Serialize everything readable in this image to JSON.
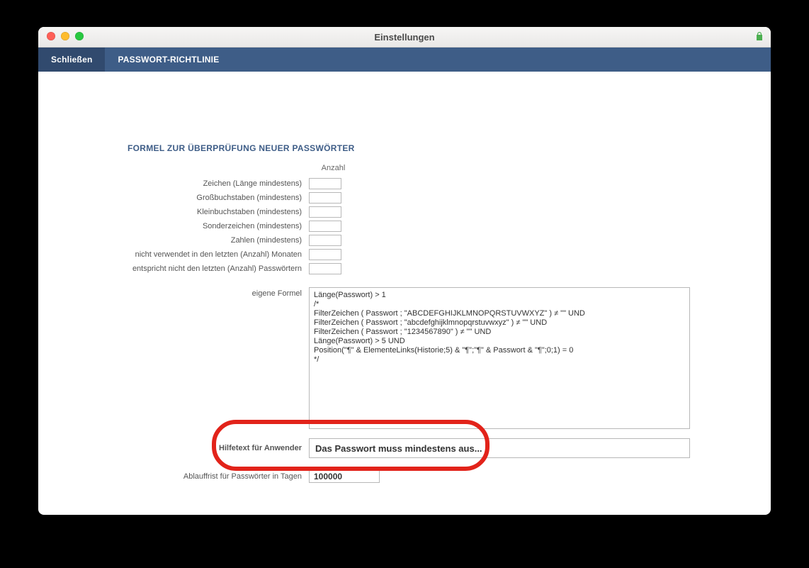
{
  "window": {
    "title": "Einstellungen"
  },
  "toolbar": {
    "close": "Schließen",
    "tab_policy": "PASSWORT-RICHTLINIE"
  },
  "section": {
    "title": "FORMEL ZUR ÜBERPRÜFUNG NEUER PASSWÖRTER",
    "count_header": "Anzahl"
  },
  "fields": {
    "chars": {
      "label": "Zeichen (Länge mindestens)",
      "value": ""
    },
    "upper": {
      "label": "Großbuchstaben (mindestens)",
      "value": ""
    },
    "lower": {
      "label": "Kleinbuchstaben (mindestens)",
      "value": ""
    },
    "special": {
      "label": "Sonderzeichen (mindestens)",
      "value": ""
    },
    "digits": {
      "label": "Zahlen (mindestens)",
      "value": ""
    },
    "months": {
      "label": "nicht verwendet in den letzten (Anzahl) Monaten",
      "value": ""
    },
    "passwords": {
      "label": "entspricht nicht den letzten (Anzahl) Passwörtern",
      "value": ""
    }
  },
  "formula": {
    "label": "eigene Formel",
    "value": "Länge(Passwort) > 1\n/*\nFilterZeichen ( Passwort ; \"ABCDEFGHIJKLMNOPQRSTUVWXYZ\" ) ≠ \"\" UND\nFilterZeichen ( Passwort ; \"abcdefghijklmnopqrstuvwxyz\" ) ≠ \"\" UND\nFilterZeichen ( Passwort ; \"1234567890\" ) ≠ \"\" UND\nLänge(Passwort) > 5 UND\nPosition(\"¶\" & ElementeLinks(Historie;5) & \"¶\";\"¶\" & Passwort & \"¶\";0;1) = 0\n*/"
  },
  "help": {
    "label": "Hilfetext für Anwender",
    "value": "Das Passwort muss mindestens aus..."
  },
  "expiry": {
    "label": "Ablauffrist für Passwörter in Tagen",
    "value": "100000"
  }
}
